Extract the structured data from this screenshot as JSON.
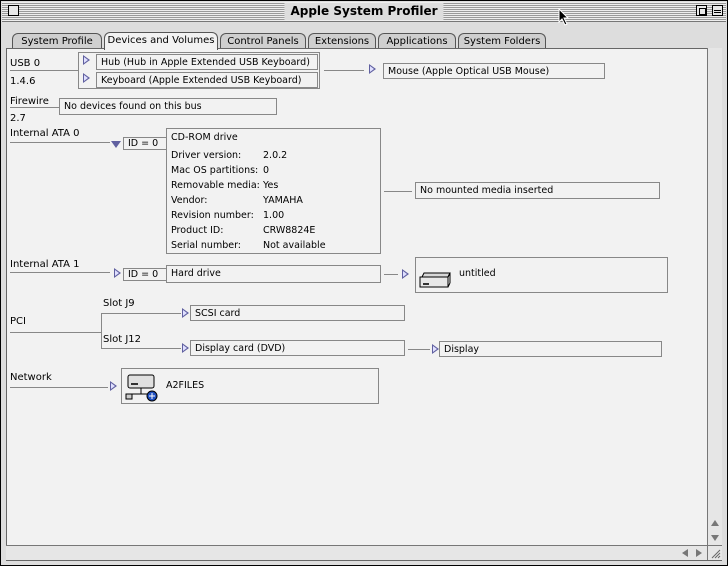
{
  "window": {
    "title": "Apple System Profiler"
  },
  "tabs": [
    {
      "label": "System Profile",
      "active": false
    },
    {
      "label": "Devices and Volumes",
      "active": true
    },
    {
      "label": "Control Panels",
      "active": false
    },
    {
      "label": "Extensions",
      "active": false
    },
    {
      "label": "Applications",
      "active": false
    },
    {
      "label": "System Folders",
      "active": false
    }
  ],
  "usb": {
    "bus_label": "USB 0",
    "version": "1.4.6",
    "hub": "Hub (Hub in Apple Extended USB Keyboard)",
    "keyboard": "Keyboard (Apple Extended USB Keyboard)",
    "mouse": "Mouse (Apple Optical USB Mouse)"
  },
  "firewire": {
    "bus_label": "Firewire",
    "version": "2.7",
    "status": "No devices found on this bus"
  },
  "ata0": {
    "bus_label": "Internal ATA 0",
    "id": "ID = 0",
    "device": "CD-ROM drive",
    "details": [
      {
        "key": "Driver version:",
        "value": "2.0.2"
      },
      {
        "key": "Mac OS partitions:",
        "value": "0"
      },
      {
        "key": "Removable media:",
        "value": "Yes"
      },
      {
        "key": "Vendor:",
        "value": "YAMAHA"
      },
      {
        "key": "Revision number:",
        "value": "1.00"
      },
      {
        "key": "Product ID:",
        "value": "CRW8824E"
      },
      {
        "key": "Serial number:",
        "value": "Not available"
      }
    ],
    "media_status": "No mounted media inserted"
  },
  "ata1": {
    "bus_label": "Internal ATA 1",
    "id": "ID = 0",
    "device": "Hard drive",
    "volume": "untitled"
  },
  "pci": {
    "bus_label": "PCI",
    "slots": [
      {
        "slot": "Slot J9",
        "card": "SCSI card"
      },
      {
        "slot": "Slot J12",
        "card": "Display card (DVD)",
        "child": "Display"
      }
    ]
  },
  "network": {
    "label": "Network",
    "server": "A2FILES"
  },
  "colors": {
    "triangle": "#6060a0",
    "background": "#f2f2f2",
    "chrome": "#dddddd"
  }
}
